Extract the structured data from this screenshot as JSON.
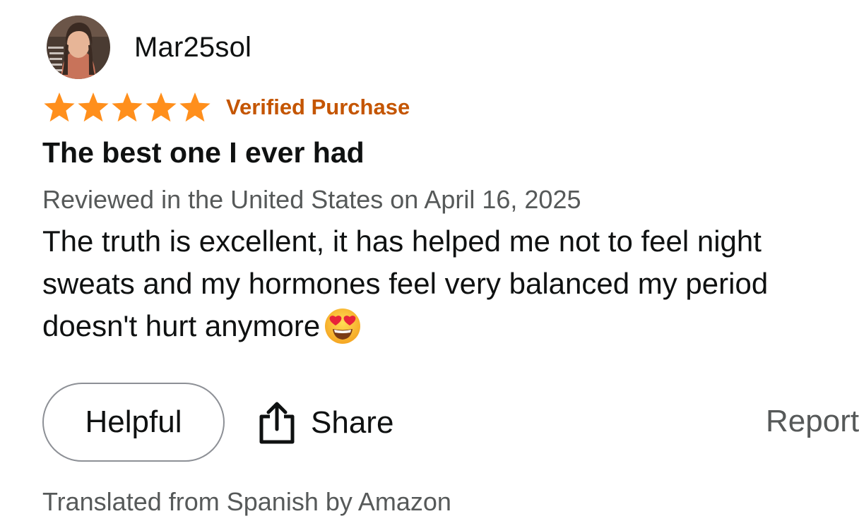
{
  "review": {
    "username": "Mar25sol",
    "rating": 5,
    "rating_max": 5,
    "verified_label": "Verified Purchase",
    "title": "The best one I ever had",
    "meta": "Reviewed in the United States on April 16, 2025",
    "body": "The truth is excellent, it has helped me not to feel night sweats and my hormones feel very balanced my period doesn't hurt anymore",
    "body_emoji": "heart-eyes-emoji"
  },
  "actions": {
    "helpful_label": "Helpful",
    "share_label": "Share",
    "share_icon": "share-icon",
    "report_label": "Report"
  },
  "footer": {
    "translated_note": "Translated from Spanish by Amazon"
  },
  "colors": {
    "star": "#ff8f1c",
    "verified": "#c45500",
    "secondary_text": "#565959",
    "button_border": "#8d9096"
  }
}
